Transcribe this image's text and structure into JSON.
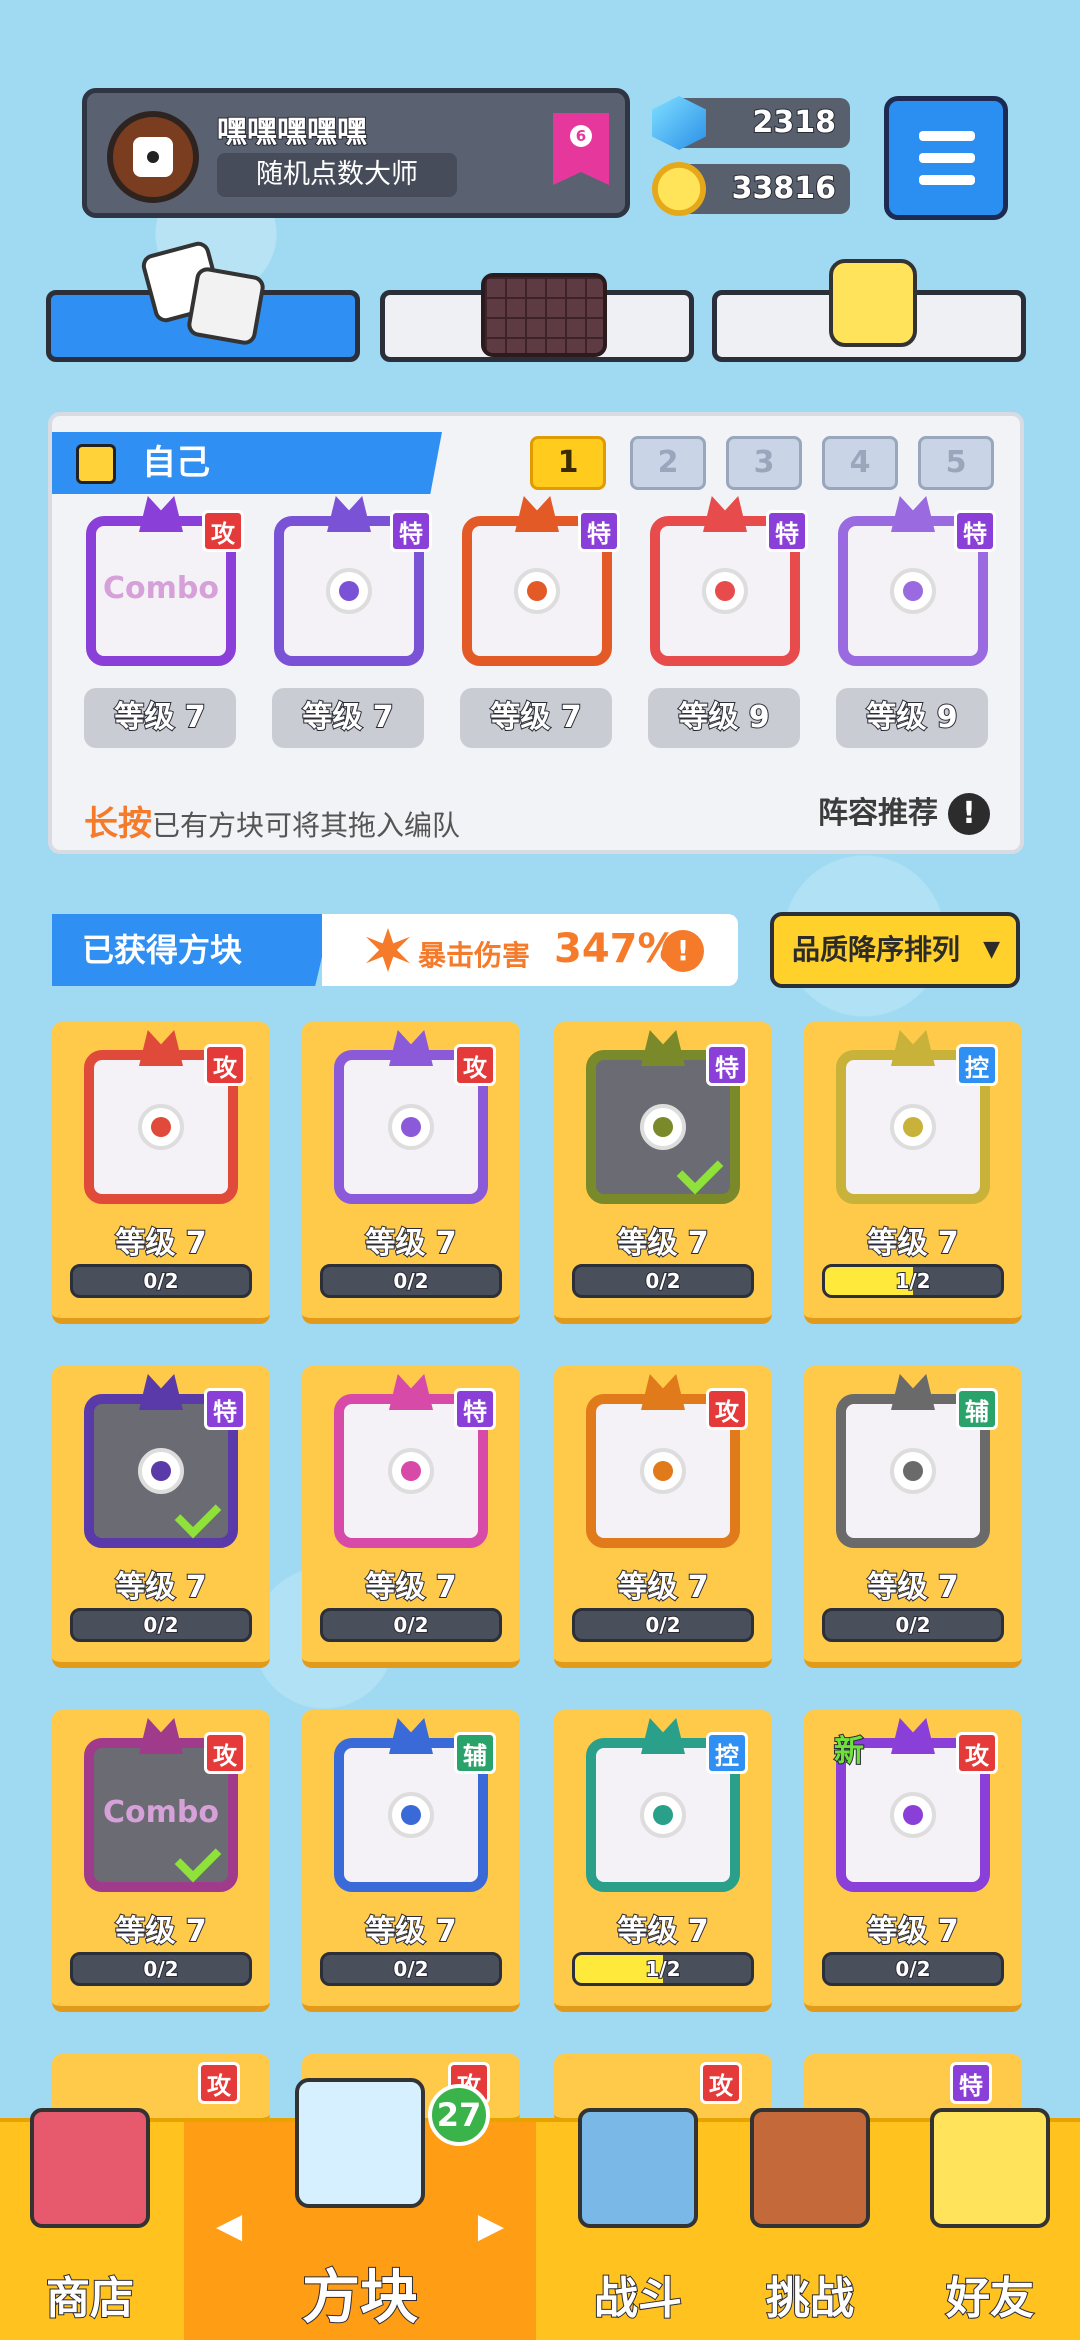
{
  "profile": {
    "name": "嘿嘿嘿嘿嘿",
    "title": "随机点数大师",
    "rank": "6"
  },
  "currency": {
    "gems": "2318",
    "coins": "33816"
  },
  "tabs": [
    {
      "name": "dice",
      "icon": "dice-icon"
    },
    {
      "name": "board",
      "icon": "board-icon"
    },
    {
      "name": "emote",
      "icon": "smile-icon"
    }
  ],
  "deck": {
    "title": "自己",
    "pages": [
      "1",
      "2",
      "3",
      "4",
      "5"
    ],
    "cards": [
      {
        "badge": "攻",
        "type": "atk",
        "color": "#8b3fd9",
        "level": "等级 7",
        "word": "Combo"
      },
      {
        "badge": "特",
        "type": "sp",
        "color": "#7a52d6",
        "level": "等级 7"
      },
      {
        "badge": "特",
        "type": "sp",
        "color": "#e45a26",
        "level": "等级 7"
      },
      {
        "badge": "特",
        "type": "sp",
        "color": "#e84b4b",
        "level": "等级 9"
      },
      {
        "badge": "特",
        "type": "sp",
        "color": "#9a6ae0",
        "level": "等级 9"
      }
    ],
    "hint_em": "长按",
    "hint_rest": "已有方块可将其拖入编队",
    "recommend": "阵容推荐",
    "recommend_icon": "!"
  },
  "owned": {
    "title": "已获得方块",
    "crit_label": "暴击伤害",
    "crit_value": "347%",
    "crit_icon": "!",
    "sort_label": "品质降序排列",
    "cards": [
      {
        "badge": "攻",
        "type": "atk",
        "color": "#e04a3a",
        "level": "等级 7",
        "progress": "0/2",
        "fill": 0,
        "dim": false
      },
      {
        "badge": "攻",
        "type": "atk",
        "color": "#8b5ad9",
        "level": "等级 7",
        "progress": "0/2",
        "fill": 0,
        "dim": false
      },
      {
        "badge": "特",
        "type": "sp",
        "color": "#7a8a2a",
        "level": "等级 7",
        "progress": "0/2",
        "fill": 0,
        "dim": true,
        "checked": true
      },
      {
        "badge": "控",
        "type": "ctl",
        "color": "#c9b23a",
        "level": "等级 7",
        "progress": "1/2",
        "fill": 0.5,
        "dim": false
      },
      {
        "badge": "特",
        "type": "sp",
        "color": "#5a3aa8",
        "level": "等级 7",
        "progress": "0/2",
        "fill": 0,
        "dim": true,
        "checked": true
      },
      {
        "badge": "特",
        "type": "sp",
        "color": "#d84aa8",
        "level": "等级 7",
        "progress": "0/2",
        "fill": 0,
        "dim": false
      },
      {
        "badge": "攻",
        "type": "atk",
        "color": "#e07a1a",
        "level": "等级 7",
        "progress": "0/2",
        "fill": 0,
        "dim": false
      },
      {
        "badge": "辅",
        "type": "sup",
        "color": "#6a6a6a",
        "level": "等级 7",
        "progress": "0/2",
        "fill": 0,
        "dim": false
      },
      {
        "badge": "攻",
        "type": "atk",
        "color": "#a03a8a",
        "level": "等级 7",
        "progress": "0/2",
        "fill": 0,
        "dim": true,
        "checked": true,
        "word": "Combo"
      },
      {
        "badge": "辅",
        "type": "sup",
        "color": "#3a6ad8",
        "level": "等级 7",
        "progress": "0/2",
        "fill": 0,
        "dim": false
      },
      {
        "badge": "控",
        "type": "ctl",
        "color": "#2aa08a",
        "level": "等级 7",
        "progress": "1/2",
        "fill": 0.5,
        "dim": false
      },
      {
        "badge": "攻",
        "type": "atk",
        "color": "#8b3fd9",
        "level": "等级 7",
        "progress": "0/2",
        "fill": 0,
        "dim": false,
        "new": "新"
      }
    ],
    "partial_row_badges": [
      "攻",
      "攻",
      "攻",
      "特"
    ]
  },
  "nav": {
    "items": [
      {
        "label": "商店",
        "icon": "shop-icon"
      },
      {
        "label": "方块",
        "icon": "dice-box-icon",
        "count": "27"
      },
      {
        "label": "战斗",
        "icon": "battle-icon"
      },
      {
        "label": "挑战",
        "icon": "challenge-icon"
      },
      {
        "label": "好友",
        "icon": "friend-icon"
      }
    ],
    "arrow_left": "◀",
    "arrow_right": "▶"
  },
  "colors": {
    "accent_blue": "#2f8ff2",
    "card_gold": "#ffc94a",
    "nav_bg": "#ffc21e",
    "attack_red": "#e53a3a",
    "special_purple": "#8b3fd9",
    "control_blue": "#2f8ff2",
    "support_green": "#2aa36a"
  }
}
